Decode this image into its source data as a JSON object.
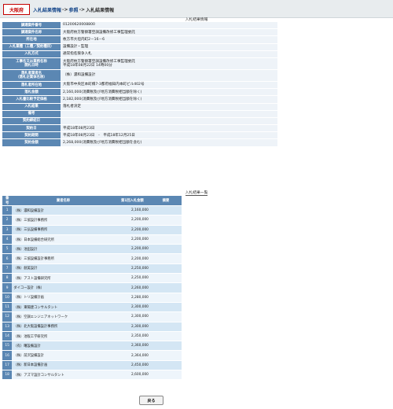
{
  "header": {
    "logo": "大阪府",
    "crumbs": [
      "入札結果情報",
      "参照",
      "入札結果情報"
    ],
    "sep": "->"
  },
  "detail": {
    "title": "入札結果情報",
    "rows": [
      {
        "label": "調達案件番号",
        "value": "01200620008800"
      },
      {
        "label": "調達案件名称",
        "value": "大阪府枚方警察署空調設備改修工事監理委託"
      },
      {
        "label": "所在地",
        "value": "枚方市大垣内町2－16－6"
      },
      {
        "label": "入札業種（工種／契約種目）",
        "value": "設備設計・監理"
      },
      {
        "label": "入札方式",
        "value": "通常指名競争入札"
      },
      {
        "label": "工事名又は業務名称\n開札日時",
        "value": "大阪府枚方警察署空調設備改修工事監理委託\n平成18年08月22日 14時00分"
      },
      {
        "label": "落札者業者名\n（落札企業体名称）",
        "value": "（株）濃和設備設計"
      },
      {
        "label": "落札者所在地",
        "value": "大阪市中央区本町橋7-3都府福知内本町ビル402号"
      },
      {
        "label": "落札金額",
        "value": "2,160,000(消費税及び地方消費税相当額を除く)"
      },
      {
        "label": "入札書比較予定価格",
        "value": "2,182,000(消費税及び地方消費税相当額を除く)"
      },
      {
        "label": "入札結果",
        "value": "落札者決定"
      },
      {
        "label": "備考",
        "value": ""
      },
      {
        "label": "契約締結日",
        "value": ""
      },
      {
        "label": "契約日",
        "value": "平成18年08月23日"
      },
      {
        "label": "契約期間",
        "value": "平成18年08月23日　-　平成18年12月25日"
      },
      {
        "label": "契約金額",
        "value": "2,268,000(消費税及び地方消費税相当額を含む)"
      }
    ]
  },
  "bid_list": {
    "title": "入札結果一覧",
    "headers": [
      "番号",
      "業者名称",
      "第1回入札金額",
      "摘要"
    ],
    "rows": [
      {
        "no": "1",
        "name": "（株）濃和設備設計",
        "amount": "2,160,000",
        "note": ""
      },
      {
        "no": "2",
        "name": "（株）三協設計事務所",
        "amount": "2,200,000",
        "note": ""
      },
      {
        "no": "3",
        "name": "（株）三弘設備事務所",
        "amount": "2,200,000",
        "note": ""
      },
      {
        "no": "4",
        "name": "（株）日本設備総合研究所",
        "amount": "2,200,000",
        "note": ""
      },
      {
        "no": "5",
        "name": "（株）池田設計",
        "amount": "2,200,000",
        "note": ""
      },
      {
        "no": "6",
        "name": "（株）三協設備設計事務所",
        "amount": "2,200,000",
        "note": ""
      },
      {
        "no": "7",
        "name": "（株）創美設計",
        "amount": "2,250,000",
        "note": ""
      },
      {
        "no": "8",
        "name": "（株）アスト設備研究所",
        "amount": "2,250,000",
        "note": ""
      },
      {
        "no": "9",
        "name": "ダイコー設計（株）",
        "amount": "2,260,000",
        "note": ""
      },
      {
        "no": "10",
        "name": "（株）トリ設備計画",
        "amount": "2,280,000",
        "note": ""
      },
      {
        "no": "11",
        "name": "（株）東陽建コンサルタント",
        "amount": "2,300,000",
        "note": ""
      },
      {
        "no": "12",
        "name": "（株）空調エンジニアネットワーク",
        "amount": "2,300,000",
        "note": ""
      },
      {
        "no": "13",
        "name": "（株）北大阪設備設計事務所",
        "amount": "2,300,000",
        "note": ""
      },
      {
        "no": "14",
        "name": "（株）池阪工学研究所",
        "amount": "2,350,000",
        "note": ""
      },
      {
        "no": "15",
        "name": "（有）曙設備設計",
        "amount": "2,360,000",
        "note": ""
      },
      {
        "no": "16",
        "name": "（株）前沢設備設計",
        "amount": "2,364,000",
        "note": ""
      },
      {
        "no": "17",
        "name": "（株）新日本設備計画",
        "amount": "2,450,000",
        "note": ""
      },
      {
        "no": "18",
        "name": "（株）アズマ設計コンサルタント",
        "amount": "2,600,000",
        "note": ""
      }
    ]
  },
  "footer": {
    "back_label": "戻る"
  }
}
